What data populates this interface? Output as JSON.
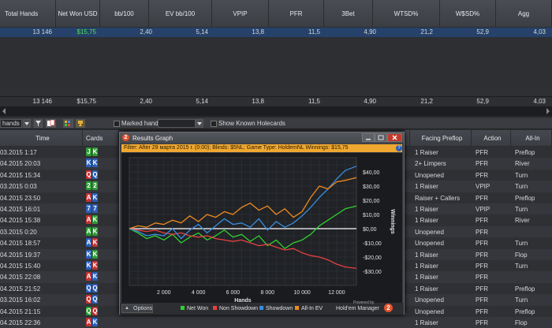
{
  "stats": {
    "headers": [
      "Total Hands",
      "Net Won USD",
      "bb/100",
      "EV bb/100",
      "VPIP",
      "PFR",
      "3Bet",
      "WTSD%",
      "W$SD%",
      "Agg"
    ],
    "row": [
      "13 146",
      "$15,75",
      "2,40",
      "5,14",
      "13,8",
      "11,5",
      "4,90",
      "21,2",
      "52,9",
      "4,03"
    ],
    "total_row": [
      "13 146",
      "$15,75",
      "2,40",
      "5,14",
      "13,8",
      "11,5",
      "4,90",
      "21,2",
      "52,9",
      "4,03"
    ]
  },
  "toolbar": {
    "view_select": "hands",
    "marked_hands": "Marked hands",
    "show_known": "Show Known Holecards"
  },
  "table": {
    "left_headers": [
      "Time",
      "Cards"
    ],
    "right_headers": [
      "Facing Preflop",
      "Action",
      "All-In"
    ],
    "rows": [
      {
        "time": "03.2015 1:17",
        "cards": [
          {
            "t": "J",
            "c": "#2f9a35"
          },
          {
            "t": "K",
            "c": "#2f9a35"
          }
        ],
        "facing": "1 Raiser",
        "action": "PFR",
        "allin": "Preflop"
      },
      {
        "time": "04.2015 20:03",
        "cards": [
          {
            "t": "K",
            "c": "#2c5fb8"
          },
          {
            "t": "K",
            "c": "#2c5fb8"
          }
        ],
        "facing": "2+ Limpers",
        "action": "PFR",
        "allin": "River"
      },
      {
        "time": "04.2015 15:34",
        "cards": [
          {
            "t": "Q",
            "c": "#c23333"
          },
          {
            "t": "Q",
            "c": "#2c5fb8"
          }
        ],
        "facing": "Unopened",
        "action": "PFR",
        "allin": "Turn"
      },
      {
        "time": "03.2015 0:03",
        "cards": [
          {
            "t": "2",
            "c": "#2f9a35"
          },
          {
            "t": "2",
            "c": "#2f9a35"
          }
        ],
        "facing": "1 Raiser",
        "action": "VPIP",
        "allin": "Turn"
      },
      {
        "time": "04.2015 23:50",
        "cards": [
          {
            "t": "A",
            "c": "#c23333"
          },
          {
            "t": "K",
            "c": "#2c5fb8"
          }
        ],
        "facing": "Raiser + Callers",
        "action": "PFR",
        "allin": "Preflop"
      },
      {
        "time": "04.2015 16:01",
        "cards": [
          {
            "t": "7",
            "c": "#2c5fb8"
          },
          {
            "t": "7",
            "c": "#2c5fb8"
          }
        ],
        "facing": "1 Raiser",
        "action": "VPIP",
        "allin": "Turn"
      },
      {
        "time": "04.2015 15:38",
        "cards": [
          {
            "t": "A",
            "c": "#c23333"
          },
          {
            "t": "K",
            "c": "#2f9a35"
          }
        ],
        "facing": "1 Raiser",
        "action": "PFR",
        "allin": "River"
      },
      {
        "time": "03.2015 0:20",
        "cards": [
          {
            "t": "A",
            "c": "#2f9a35"
          },
          {
            "t": "K",
            "c": "#2f9a35"
          }
        ],
        "facing": "Unopened",
        "action": "PFR",
        "allin": ""
      },
      {
        "time": "04.2015 18:57",
        "cards": [
          {
            "t": "A",
            "c": "#2c5fb8"
          },
          {
            "t": "K",
            "c": "#c23333"
          }
        ],
        "facing": "Unopened",
        "action": "PFR",
        "allin": "Turn"
      },
      {
        "time": "04.2015 19:37",
        "cards": [
          {
            "t": "K",
            "c": "#2c5fb8"
          },
          {
            "t": "K",
            "c": "#2f9a35"
          }
        ],
        "facing": "1 Raiser",
        "action": "PFR",
        "allin": "Flop"
      },
      {
        "time": "04.2015 15:40",
        "cards": [
          {
            "t": "K",
            "c": "#2c5fb8"
          },
          {
            "t": "K",
            "c": "#c23333"
          }
        ],
        "facing": "1 Raiser",
        "action": "PFR",
        "allin": "Turn"
      },
      {
        "time": "04.2015 22:08",
        "cards": [
          {
            "t": "A",
            "c": "#c23333"
          },
          {
            "t": "K",
            "c": "#2c5fb8"
          }
        ],
        "facing": "1 Raiser",
        "action": "PFR",
        "allin": ""
      },
      {
        "time": "04.2015 21:52",
        "cards": [
          {
            "t": "Q",
            "c": "#2c5fb8"
          },
          {
            "t": "Q",
            "c": "#2c5fb8"
          }
        ],
        "facing": "1 Raiser",
        "action": "PFR",
        "allin": "Preflop"
      },
      {
        "time": "03.2015 16:02",
        "cards": [
          {
            "t": "Q",
            "c": "#c23333"
          },
          {
            "t": "Q",
            "c": "#2c5fb8"
          }
        ],
        "facing": "Unopened",
        "action": "PFR",
        "allin": "Turn"
      },
      {
        "time": "04.2015 21:15",
        "cards": [
          {
            "t": "Q",
            "c": "#2f9a35"
          },
          {
            "t": "Q",
            "c": "#c23333"
          }
        ],
        "facing": "Unopened",
        "action": "PFR",
        "allin": "Preflop"
      },
      {
        "time": "04.2015 22:36",
        "cards": [
          {
            "t": "A",
            "c": "#c23333"
          },
          {
            "t": "K",
            "c": "#2c5fb8"
          }
        ],
        "facing": "1 Raiser",
        "action": "PFR",
        "allin": "Flop"
      }
    ]
  },
  "graph": {
    "title": "Results Graph",
    "filter": "Filter: After 29 марта 2015 г. (0:00); Blinds: $5NL; Game Type: HoldemNL Winnings: $15,75",
    "options": "Options",
    "powered_by": "Powered by",
    "brand": "Hold'em Manager",
    "brand_badge": "2",
    "badge": "2"
  },
  "chart_data": {
    "type": "line",
    "xlabel": "Hands",
    "ylabel": "Winnings",
    "xlim": [
      0,
      13146
    ],
    "ylim": [
      -40,
      50
    ],
    "x_ticks": [
      "2 000",
      "4 000",
      "6 000",
      "8 000",
      "10 000",
      "12 000"
    ],
    "y_ticks": [
      "$40,00",
      "$30,00",
      "$20,00",
      "$10,00",
      "$0,00",
      "-$10,00",
      "-$20,00",
      "-$30,00"
    ],
    "y_tick_values": [
      40,
      30,
      20,
      10,
      0,
      -10,
      -20,
      -30
    ],
    "x_tick_values": [
      2000,
      4000,
      6000,
      8000,
      10000,
      12000
    ],
    "x": [
      0,
      500,
      1000,
      1500,
      2000,
      2500,
      3000,
      3500,
      4000,
      4500,
      5000,
      5500,
      6000,
      6500,
      7000,
      7500,
      8000,
      8500,
      9000,
      9500,
      10000,
      10500,
      11000,
      11500,
      12000,
      12500,
      13146
    ],
    "series": [
      {
        "name": "Net Won",
        "color": "#2fd12f",
        "values": [
          0,
          -3,
          -7,
          -5,
          -8,
          -4,
          -10,
          -6,
          -3,
          -8,
          -5,
          -1,
          -6,
          -4,
          -9,
          -5,
          -12,
          -8,
          -14,
          -10,
          -8,
          -4,
          2,
          6,
          10,
          14,
          16
        ]
      },
      {
        "name": "Non Showdown",
        "color": "#e84040",
        "values": [
          0,
          -1,
          -2,
          -1,
          -3,
          -4,
          -3,
          -5,
          -6,
          -5,
          -7,
          -8,
          -9,
          -8,
          -10,
          -12,
          -11,
          -13,
          -15,
          -14,
          -17,
          -19,
          -20,
          -22,
          -25,
          -27,
          -28
        ]
      },
      {
        "name": "Showdown",
        "color": "#3a8de0",
        "values": [
          0,
          -2,
          -5,
          -4,
          -5,
          0,
          -7,
          -1,
          3,
          -3,
          2,
          7,
          3,
          4,
          1,
          7,
          -1,
          5,
          1,
          4,
          9,
          15,
          22,
          28,
          35,
          41,
          44
        ]
      },
      {
        "name": "All-In EV",
        "color": "#f08a20",
        "values": [
          0,
          2,
          1,
          4,
          3,
          6,
          4,
          9,
          5,
          10,
          8,
          12,
          10,
          15,
          18,
          13,
          16,
          10,
          14,
          8,
          12,
          22,
          30,
          28,
          33,
          34,
          36
        ]
      }
    ]
  }
}
